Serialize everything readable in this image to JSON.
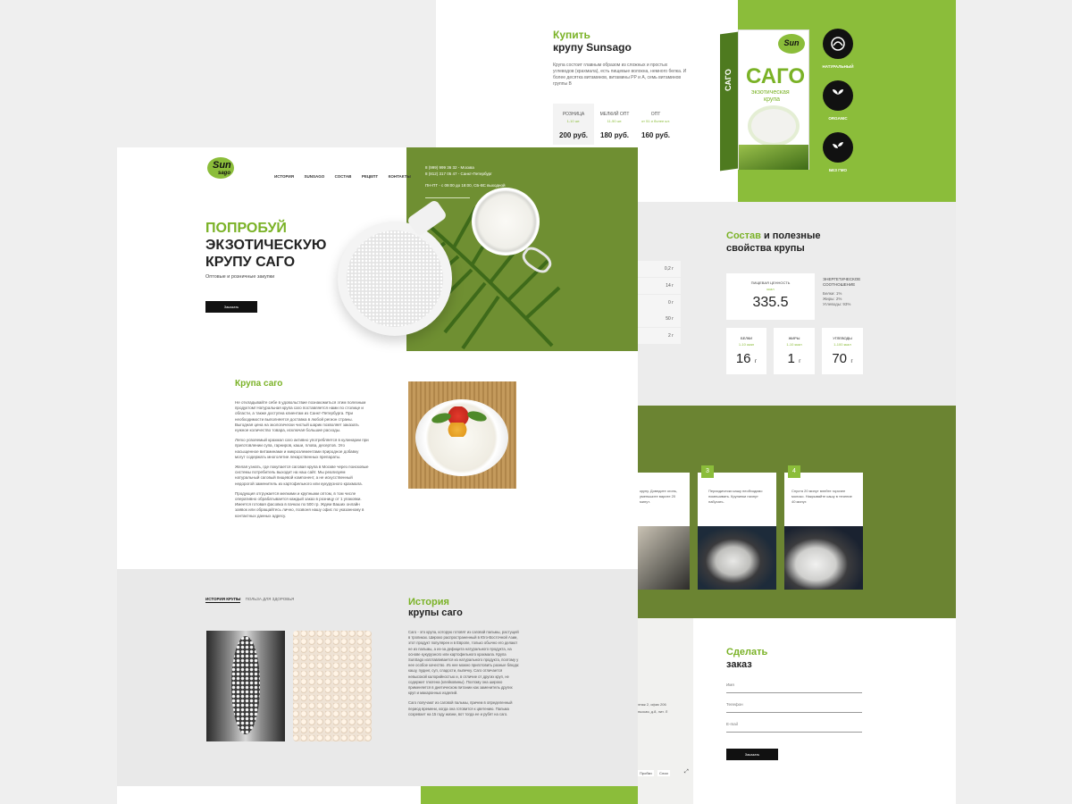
{
  "buy": {
    "title_line1": "Купить",
    "title_line2": "крупу Sunsago",
    "desc": "Крупа состоит главным образом из сложных и простых углеводов (крахмала), есть пищевые волокна, немного белка. И более десятка витаминов, витамины PP и А, семь витаминов группы B",
    "prices": [
      {
        "label": "РОЗНИЦА",
        "sub": "1-10 шт.",
        "value": "200 руб."
      },
      {
        "label": "МЕЛКИЙ ОПТ",
        "sub": "11-50 шт.",
        "value": "180 руб."
      },
      {
        "label": "ОПТ",
        "sub": "от 51 и более шт.",
        "value": "160 руб."
      }
    ]
  },
  "package": {
    "brand": "Sun",
    "brand2": "sago",
    "word": "САГО",
    "line1": "экзотическая",
    "line2": "крупа"
  },
  "badges": [
    {
      "icon": "leaf-icon",
      "label": "НАТУРАЛЬНЫЙ"
    },
    {
      "icon": "sprout-icon",
      "label": "ORGANIC"
    },
    {
      "icon": "plant-icon",
      "label": "БЕЗ ГМО"
    }
  ],
  "header": {
    "logo": "Sun",
    "logo_sub": "sago",
    "nav": [
      "ИСТОРИЯ",
      "SUNSAGO",
      "СОСТАВ",
      "РЕЦЕПТ",
      "КОНТАКТЫ"
    ],
    "contact_line1": "8 (999) 999 36 32 - Москва",
    "contact_line2": "8 (812) 317 05 47 - Санкт-Петербург",
    "hours": "ПН-ПТ - с 09:00 до 18:00, СБ-ВС выходной"
  },
  "hero": {
    "title_green": "ПОПРОБУЙ",
    "title_line2": "ЭКЗОТИЧЕСКУЮ",
    "title_line3": "КРУПУ САГО",
    "subtitle": "Оптовые и розничные закупки",
    "cta": "Заказать"
  },
  "about": {
    "title": "Крупа саго",
    "p1": "Не откладывайте себе в удовольствие познакомиться этим полезным продуктом! Натуральная крупа саго поставляется нами по столице и области, а также доступна клиентам из Санкт-Петербурга. При необходимости выполняется доставка в любой регион страны. Выгодная цена на экологически чистый шарик позволяет заказать нужное количество товара, исключая большие расходы.",
    "p2": "Легко усвояемый крахмал саго активно употребляется в кулинарии при приготовлении супа, гарниров, каши, плова, десертов. Это насыщенное витаминами и микроэлементами природное добавку могут содержать многолетие лекарственных препараты.",
    "p3": "Желая узнать, где покупается саговая крупа в Москве через поисковые системы потребитель выходит на наш сайт. Мы реализуем натуральный саговый пищевой компонент, а не искусственный недорогой заменитель из картофельного или кукурузного крахмала.",
    "p4": "Продукция отгружается мелкими и крупными оптом, в том числе оперативно обрабатывается каждый заказ в розницу от 1 упаковки. Имеется готовая фасовка в пачках по 500 гр. Ждем Ваших онлайн заявок или обращайтесь лично, позвоня нашу офис по указанному в контактных данных адресу."
  },
  "history": {
    "tab_active": "ИСТОРИЯ КРУПЫ",
    "tab_other": "ПОЛЬЗА ДЛЯ ЗДОРОВЬЯ",
    "title_green": "История",
    "title": "крупы саго",
    "p1": "Саго - это крупа, которую готовят из саговой пальмы, растущей в тропиках. Широко распространенный в Юго-Восточной Азии, этот продукт популярен и в Европе, только обычно его делают не из пальмы, а из-за дефицита натурального продукта, на основе кукурузного или картофельного крахмала. Крупа SunSago изготавливается из натурального продукта, поэтому у нее особое качество. Из нее можно приготовить разные блюда: кашу, пудинг, суп, сладости, выпечку. Саго отличается невысокой калорийностью и, в отличие от других круп, не содержит глютена (клейковины). Поэтому она широко применяется в диетическом питании как заменитель других круп и макаронных изделий.",
    "p2": "Саго получают из саговой пальмы, причем в определенный период времени, когда она готовится к цветению. Пальма созревает на 15 году жизни, вот тогда ее и рубят на саго."
  },
  "composition": {
    "title_green": "Состав",
    "title_rest": " и полезные",
    "title_line2": "свойства крупы",
    "energy_label": "ПИЩЕВАЯ ЦЕННОСТЬ",
    "energy_unit": "ккал",
    "energy_value": "335.5",
    "ratio_title": "ЭНЕРГЕТИЧЕСКОЕ СООТНОШЕНИЕ",
    "ratio_lines": [
      "Белки: 1%",
      "Жиры: 2%",
      "Углеводы: 93%"
    ],
    "macros": [
      {
        "label": "БЕЛКИ",
        "sub": "1-10 ккал",
        "value": "16",
        "unit": "г"
      },
      {
        "label": "ЖИРЫ",
        "sub": "1-10 ккал",
        "value": "1",
        "unit": "г"
      },
      {
        "label": "УГЛЕВОДЫ",
        "sub": "1-100 ккал",
        "value": "70",
        "unit": "г"
      }
    ],
    "left_rows": [
      "0,2 г",
      "14 г",
      "0 г",
      "50 г",
      "2 г"
    ]
  },
  "recipe": {
    "step_partial_text": "крупу. Доведите огонь, уменьшите варите 20 минут.",
    "steps": [
      {
        "num": "3",
        "text": "Периодически кашу необходимо помешивать. Крупинки начнут набухать."
      },
      {
        "num": "4",
        "text": "Спустя 20 минут влейте горячее молоко. Накрывайте кашу в течение 40 минут."
      }
    ]
  },
  "order": {
    "title_green": "Сделать",
    "title": "заказ",
    "fields": [
      "Имя",
      "Телефон",
      "E-mail"
    ],
    "submit": "Заказать",
    "address_line1": "этаж 2, офис 206",
    "address_line2": "пьская, д.8, лит. Л",
    "map_btn1": "Пробки",
    "map_btn2": "Слои"
  },
  "colors": {
    "accent": "#8bbd3a",
    "olive": "#6b8432",
    "dark": "#111111"
  }
}
